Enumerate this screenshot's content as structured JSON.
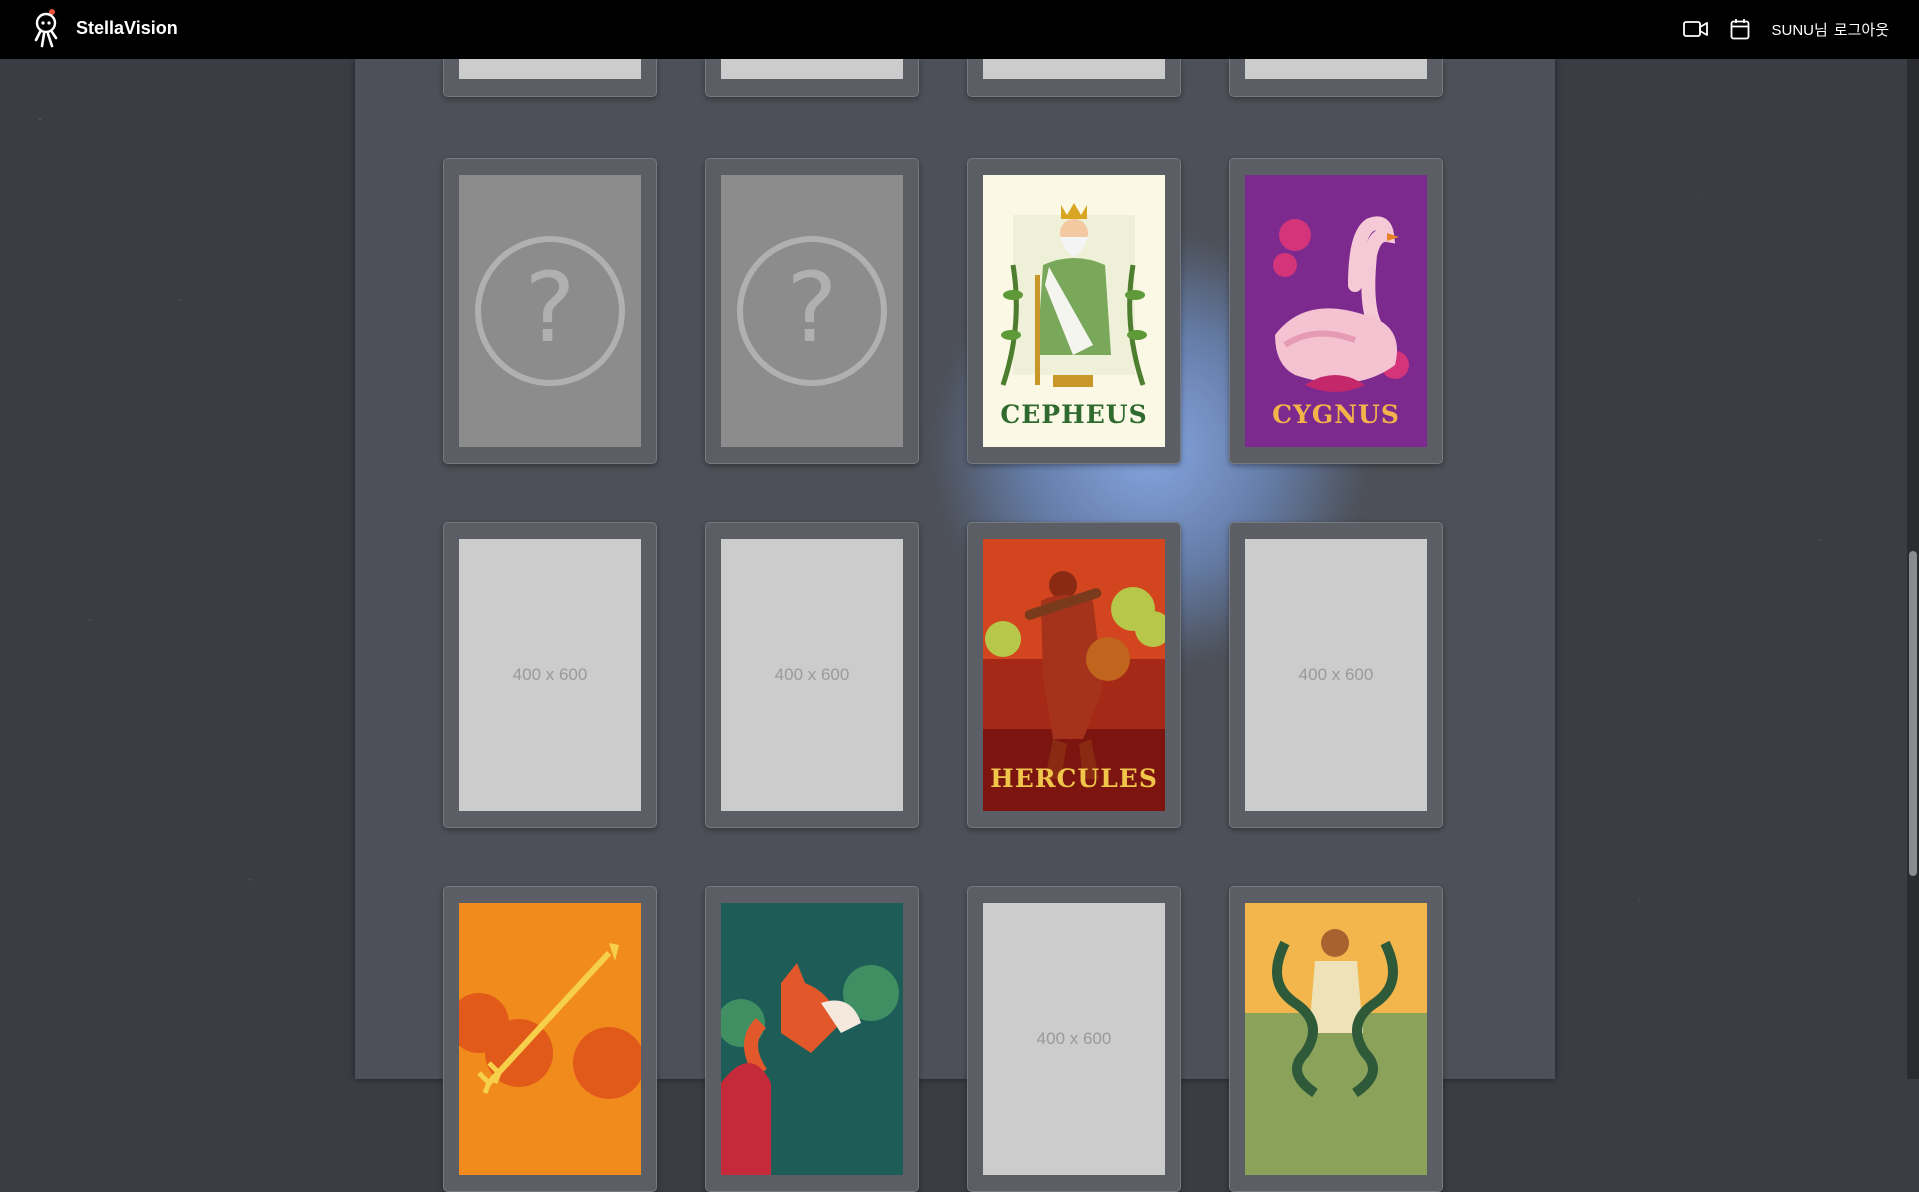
{
  "header": {
    "brand": "StellaVision",
    "username": "SUNU님",
    "logout_label": "로그아웃"
  },
  "colors": {
    "topbar": "#000000",
    "panel": "#4d5058",
    "background": "#3a3d44"
  },
  "icons": {
    "video": "video-camera-icon",
    "calendar": "calendar-icon",
    "logo": "astronaut-logo-icon"
  },
  "cards": {
    "row0": [
      {
        "state": "placeholder-partial"
      },
      {
        "state": "placeholder-partial"
      },
      {
        "state": "placeholder-partial"
      },
      {
        "state": "placeholder-partial"
      }
    ],
    "row1": [
      {
        "state": "unknown",
        "glyph": "?"
      },
      {
        "state": "unknown",
        "glyph": "?"
      },
      {
        "state": "revealed",
        "title": "CEPHEUS"
      },
      {
        "state": "revealed",
        "title": "CYGNUS"
      }
    ],
    "row2": [
      {
        "state": "placeholder",
        "label": "400 x 600"
      },
      {
        "state": "placeholder",
        "label": "400 x 600"
      },
      {
        "state": "revealed",
        "title": "HERCULES"
      },
      {
        "state": "placeholder",
        "label": "400 x 600"
      }
    ],
    "row3": [
      {
        "state": "revealed-partial"
      },
      {
        "state": "revealed-partial"
      },
      {
        "state": "placeholder",
        "label": "400 x 600"
      },
      {
        "state": "revealed-partial"
      }
    ]
  }
}
